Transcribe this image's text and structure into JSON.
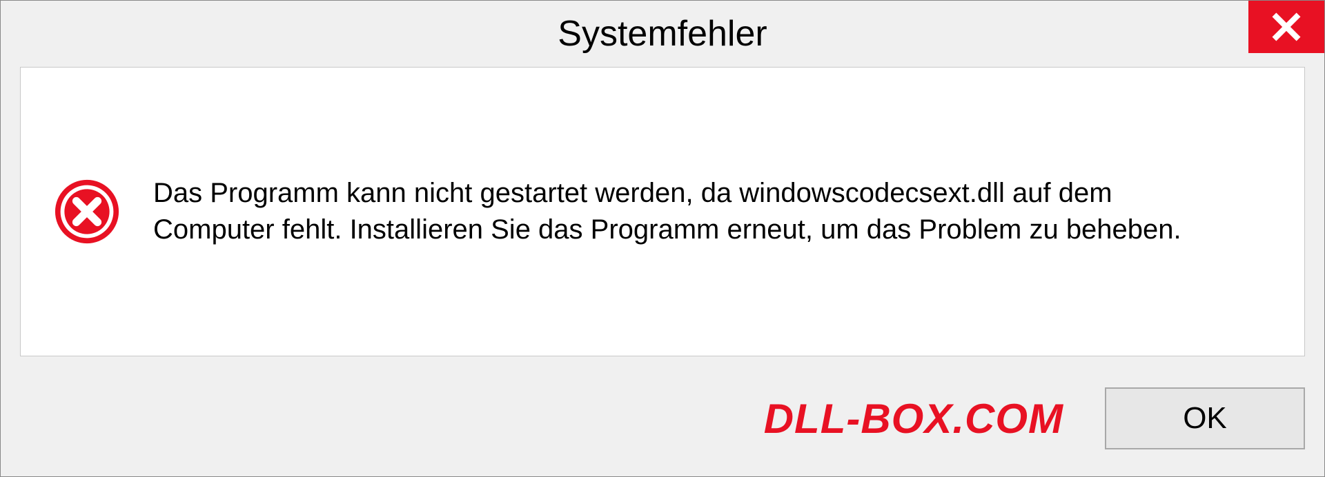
{
  "dialog": {
    "title": "Systemfehler",
    "message": "Das Programm kann nicht gestartet werden, da windowscodecsext.dll auf dem Computer fehlt. Installieren Sie das Programm erneut, um das Problem zu beheben.",
    "ok_label": "OK"
  },
  "watermark": "DLL-BOX.COM",
  "colors": {
    "error_red": "#e81123",
    "dialog_bg": "#f0f0f0",
    "content_bg": "#ffffff"
  },
  "icons": {
    "close": "close-icon",
    "error": "error-circle-icon"
  }
}
